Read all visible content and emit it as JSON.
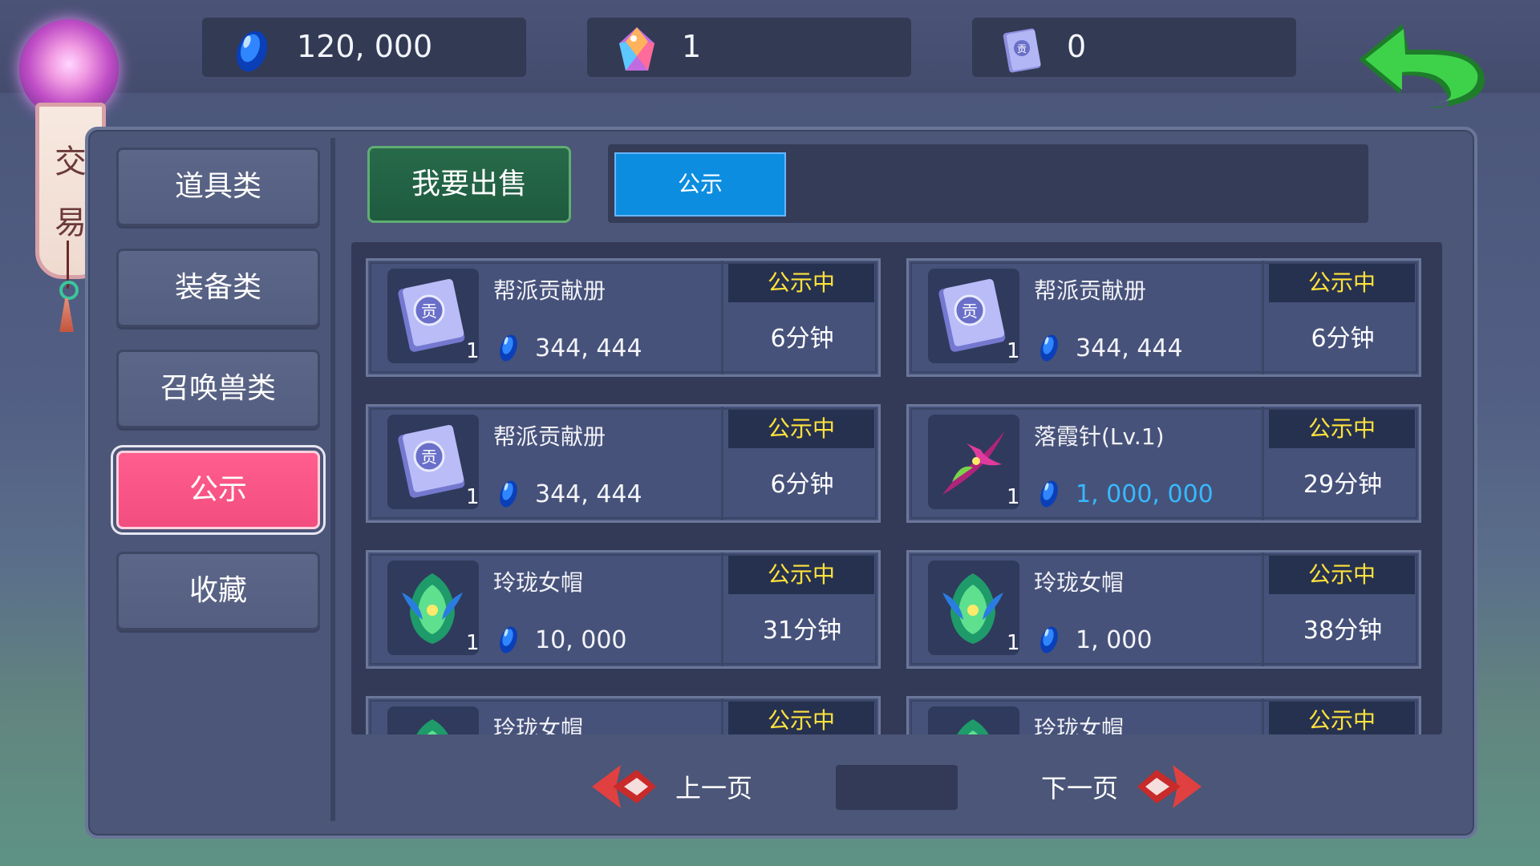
{
  "resources": [
    {
      "icon": "blue-gem-icon",
      "value": "120, 000"
    },
    {
      "icon": "rainbow-crystal-icon",
      "value": "1"
    },
    {
      "icon": "contribution-book-icon",
      "value": "0"
    }
  ],
  "sidebar_title": [
    "交",
    "易"
  ],
  "categories": [
    {
      "label": "道具类",
      "active": false
    },
    {
      "label": "装备类",
      "active": false
    },
    {
      "label": "召唤兽类",
      "active": false
    },
    {
      "label": "公示",
      "active": true
    },
    {
      "label": "收藏",
      "active": false
    }
  ],
  "sell_button": "我要出售",
  "tabs": [
    {
      "label": "公示",
      "active": true
    }
  ],
  "items": [
    {
      "name": "帮派贡献册",
      "icon": "contribution-book-icon",
      "count": "1",
      "price": "344, 444",
      "price_color": "white",
      "status": "公示中",
      "time": "6分钟"
    },
    {
      "name": "帮派贡献册",
      "icon": "contribution-book-icon",
      "count": "1",
      "price": "344, 444",
      "price_color": "white",
      "status": "公示中",
      "time": "6分钟"
    },
    {
      "name": "帮派贡献册",
      "icon": "contribution-book-icon",
      "count": "1",
      "price": "344, 444",
      "price_color": "white",
      "status": "公示中",
      "time": "6分钟"
    },
    {
      "name": "落霞针(Lv.1)",
      "icon": "crimson-needle-weapon-icon",
      "count": "1",
      "price": "1, 000, 000",
      "price_color": "blue",
      "status": "公示中",
      "time": "29分钟"
    },
    {
      "name": "玲珑女帽",
      "icon": "green-phoenix-hat-icon",
      "count": "1",
      "price": "10, 000",
      "price_color": "white",
      "status": "公示中",
      "time": "31分钟"
    },
    {
      "name": "玲珑女帽",
      "icon": "green-phoenix-hat-icon",
      "count": "1",
      "price": "1, 000",
      "price_color": "white",
      "status": "公示中",
      "time": "38分钟"
    },
    {
      "name": "玲珑女帽",
      "icon": "green-phoenix-hat-icon",
      "count": "",
      "price": "",
      "price_color": "white",
      "status": "公示中",
      "time": ""
    },
    {
      "name": "玲珑女帽",
      "icon": "green-phoenix-hat-icon",
      "count": "",
      "price": "",
      "price_color": "white",
      "status": "公示中",
      "time": ""
    }
  ],
  "pagination": {
    "prev": "上一页",
    "next": "下一页",
    "page": ""
  },
  "colors": {
    "accent_pink": "#f24d7f",
    "tab_blue": "#0d8de0",
    "status_yellow": "#ffe23b",
    "price_blue": "#37b9ff",
    "sell_green": "#1f5b3f"
  }
}
